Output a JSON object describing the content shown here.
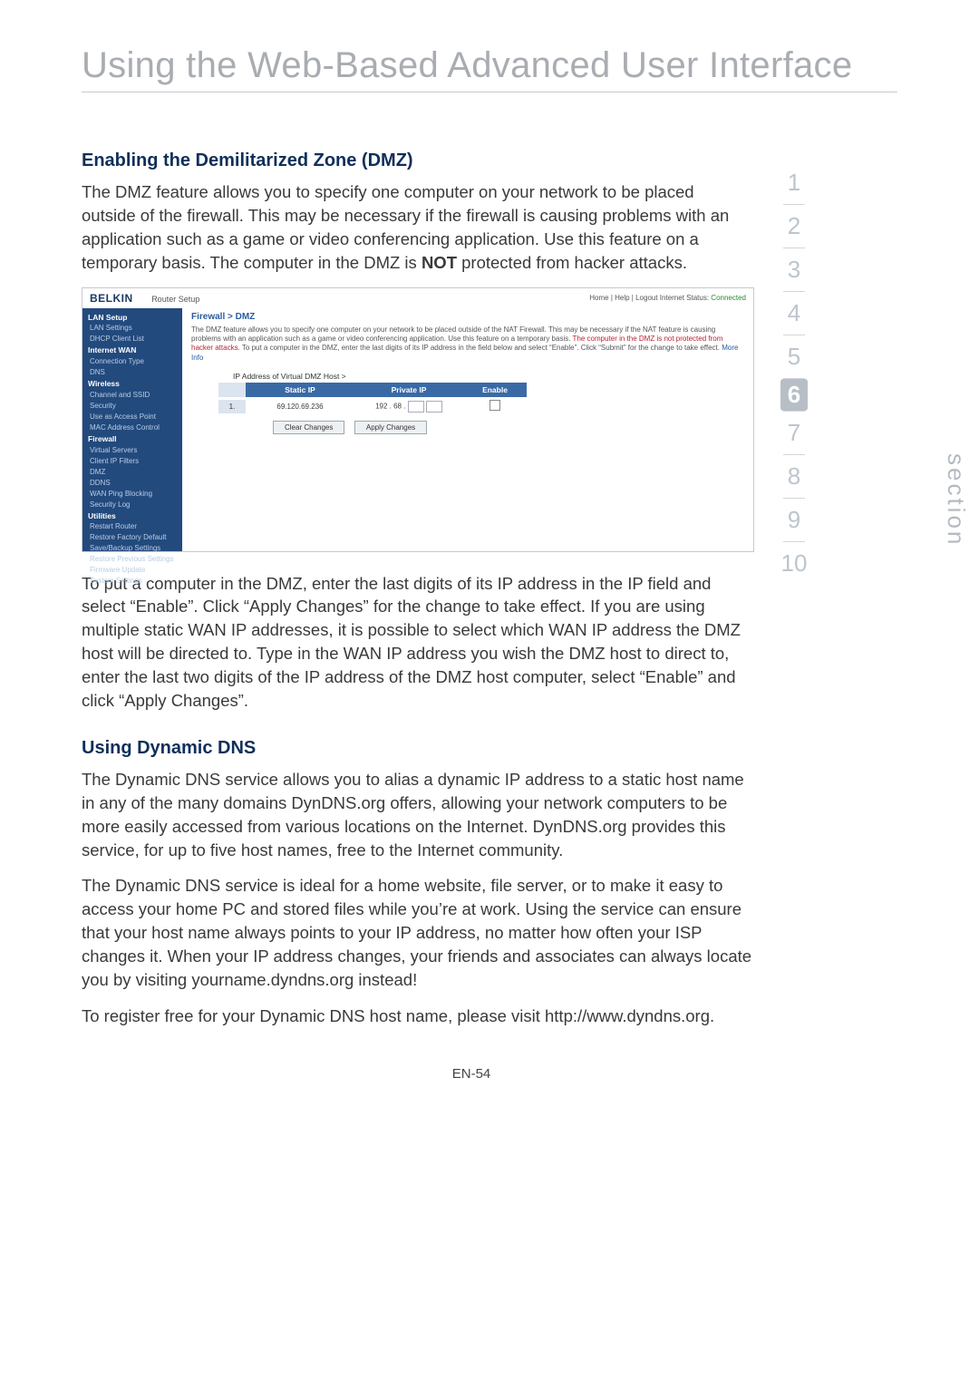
{
  "chapterTitle": "Using the Web-Based Advanced User Interface",
  "verticalLabel": "section",
  "footer": "EN-54",
  "sections": {
    "dmz": {
      "heading": "Enabling the Demilitarized Zone (DMZ)",
      "p1_a": "The DMZ feature allows you to specify one computer on your network to be placed outside of the firewall. This may be necessary if the firewall is causing problems with an application such as a game or video conferencing application. Use this feature on a temporary basis. The computer in the DMZ is ",
      "p1_not": "NOT",
      "p1_b": " protected from hacker attacks.",
      "p2": "To put a computer in the DMZ, enter the last digits of its IP address in the IP field and select “Enable”. Click “Apply Changes” for the change to take effect. If you are using multiple static WAN IP addresses, it is possible to select which WAN IP address the DMZ host will be directed to. Type in the WAN IP address you wish the DMZ host to direct to, enter the last two digits of the IP address of the DMZ host computer, select “Enable” and click “Apply Changes”."
    },
    "ddns": {
      "heading": "Using Dynamic DNS",
      "p1": "The Dynamic DNS service allows you to alias a dynamic IP address to a static host name in any of the many domains DynDNS.org offers, allowing your network computers to be more easily accessed from various locations on the Internet. DynDNS.org provides this service, for up to five host names, free to the Internet community.",
      "p2": "The Dynamic DNS service is ideal for a home website, file server, or to make it easy to access your home PC and stored files while you’re at work. Using the service can ensure that your host name always points to your IP address, no matter how often your ISP changes it. When your IP address changes, your friends and associates can always locate you by visiting yourname.dyndns.org instead!",
      "p3": "To register free for your Dynamic DNS host name, please visit http://www.dyndns.org."
    }
  },
  "sideNumbers": [
    "1",
    "2",
    "3",
    "4",
    "5",
    "6",
    "7",
    "8",
    "9",
    "10"
  ],
  "activeSection": "6",
  "screenshot": {
    "logo": "BELKIN",
    "subtitle": "Router Setup",
    "topLinks": "Home | Help | Logout    Internet Status:",
    "status": "Connected",
    "crumb": "Firewall > DMZ",
    "descA": "The DMZ feature allows you to specify one computer on your network to be placed outside of the NAT Firewall. This may be necessary if the NAT feature is causing problems with an application such as a game or video conferencing application. Use this feature on a temporary basis. ",
    "descRed": "The computer in the DMZ is not protected from hacker attacks.",
    "descB": " To put a computer in the DMZ, enter the last digits of its IP address in the field below and select “Enable”. Click “Submit” for the change to take effect. ",
    "moreInfo": "More Info",
    "tableLabel": "IP Address of Virtual DMZ Host >",
    "cols": {
      "static": "Static IP",
      "private": "Private IP",
      "enable": "Enable"
    },
    "row": {
      "num": "1.",
      "static": "69.120.69.236",
      "privPrefix": "192 . 68 ."
    },
    "clearBtn": "Clear Changes",
    "applyBtn": "Apply Changes",
    "nav": {
      "g1": "LAN Setup",
      "i1": "LAN Settings",
      "i2": "DHCP Client List",
      "g2": "Internet WAN",
      "i3": "Connection Type",
      "i4": "DNS",
      "g3": "Wireless",
      "i5": "Channel and SSID",
      "i6": "Security",
      "i7": "Use as Access Point",
      "i8": "MAC Address Control",
      "g4": "Firewall",
      "i9": "Virtual Servers",
      "i10": "Client IP Filters",
      "i11": "DMZ",
      "i12": "DDNS",
      "i13": "WAN Ping Blocking",
      "i14": "Security Log",
      "g5": "Utilities",
      "i15": "Restart Router",
      "i16": "Restore Factory Default",
      "i17": "Save/Backup Settings",
      "i18": "Restore Previous Settings",
      "i19": "Firmware Update",
      "i20": "System Settings"
    }
  }
}
